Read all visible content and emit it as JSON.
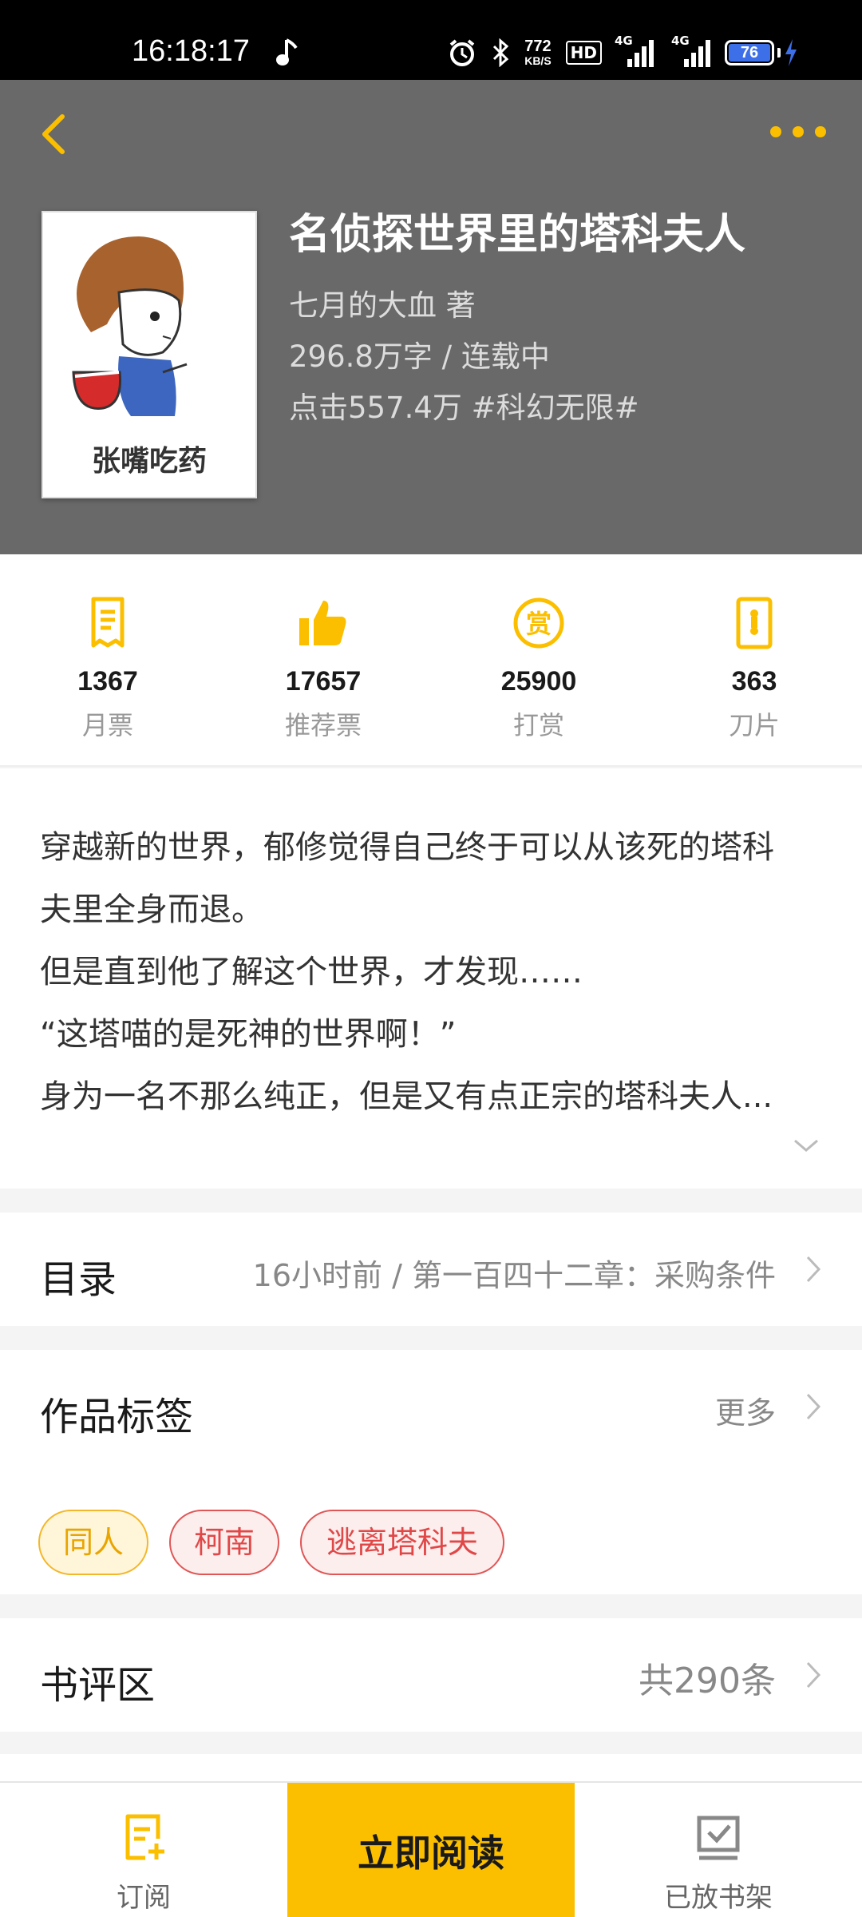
{
  "status_bar": {
    "time": "16:18:17",
    "net_speed_value": "772",
    "net_speed_unit": "KB/S",
    "hd_label": "HD",
    "signal1_label": "4G",
    "signal2_label": "4G",
    "battery_level": "76"
  },
  "book": {
    "title": "名侦探世界里的塔科夫人",
    "author_line": "七月的大血  著",
    "words_status": "296.8万字 / 连载中",
    "clicks_category": "点击557.4万  #科幻无限#",
    "cover_caption": "张嘴吃药"
  },
  "stats": [
    {
      "icon": "monthly-ticket-icon",
      "value": "1367",
      "label": "月票"
    },
    {
      "icon": "thumbs-up-icon",
      "value": "17657",
      "label": "推荐票"
    },
    {
      "icon": "reward-icon",
      "value": "25900",
      "label": "打赏"
    },
    {
      "icon": "blade-icon",
      "value": "363",
      "label": "刀片"
    }
  ],
  "synopsis": {
    "lines": [
      "穿越新的世界，郁修觉得自己终于可以从该死的塔科",
      "夫里全身而退。",
      "但是直到他了解这个世界，才发现……",
      "“这塔喵的是死神的世界啊！”",
      "身为一名不那么纯正，但是又有点正宗的塔科夫人..."
    ]
  },
  "catalog": {
    "title": "目录",
    "latest": "16小时前 / 第一百四十二章：采购条件"
  },
  "tags_section": {
    "title": "作品标签",
    "more": "更多",
    "tags": [
      "同人",
      "柯南",
      "逃离塔科夫"
    ]
  },
  "reviews": {
    "title": "书评区",
    "count": "共290条"
  },
  "bottom_bar": {
    "subscribe": "订阅",
    "read_now": "立即阅读",
    "on_shelf": "已放书架"
  },
  "colors": {
    "accent": "#fbbf00",
    "header_bg": "#696969",
    "tag_red": "#e04848",
    "tag_yellow": "#e9a400"
  }
}
